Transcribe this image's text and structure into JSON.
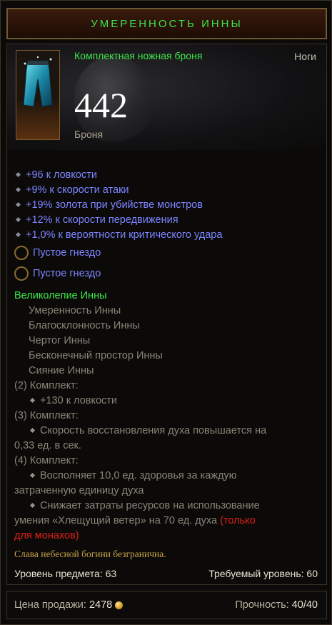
{
  "tooltip": {
    "title": "УМЕРЕННОСТЬ ИННЫ",
    "item_type": "Комплектная ножная броня",
    "slot": "Ноги",
    "armor_value": "442",
    "armor_label": "Броня",
    "item_icon": "pants-icon",
    "properties": [
      "+96 к ловкости",
      "+9% к скорости атаки",
      "+19% золота при убийстве монстров",
      "+12% к скорости передвижения",
      "+1,0% к вероятности критического удара"
    ],
    "sockets": [
      "Пустое гнездо",
      "Пустое гнездо"
    ],
    "set": {
      "name": "Великолепие Инны",
      "items": [
        "Умеренность Инны",
        "Благосклонность Инны",
        "Чертог Инны",
        "Бесконечный простор Инны",
        "Сияние Инны"
      ],
      "bonus_2_label": "(2) Комплект:",
      "bonus_2": "+130 к ловкости",
      "bonus_3_label": "(3) Комплект:",
      "bonus_3_line1": "Скорость восстановления духа повышается на",
      "bonus_3_line2": "0,33 ед. в сек.",
      "bonus_4_label": "(4) Комплект:",
      "bonus_4a_line1": "Восполняет 10,0 ед. здоровья за каждую",
      "bonus_4a_line2": "затраченную единицу духа",
      "bonus_4b_line1": "Снижает затраты ресурсов на использование",
      "bonus_4b_line2": "умения «Хлещущий ветер» на 70 ед. духа",
      "bonus_4b_red1": "(только",
      "bonus_4b_red2": "для монахов)"
    },
    "flavor": "Слава небесной богини безгранична.",
    "item_level": "Уровень предмета: 63",
    "required_level": "Требуемый уровень: 60",
    "sell_label": "Цена продажи:",
    "sell_value": "2478",
    "durability_label": "Прочность:",
    "durability_value": "40/40"
  },
  "colors": {
    "title": "#3ee64a",
    "magic": "#7c84ff",
    "set": "#3ee64a",
    "grey": "#8a8478",
    "red": "#e0201a",
    "flavor": "#c8a24a"
  }
}
